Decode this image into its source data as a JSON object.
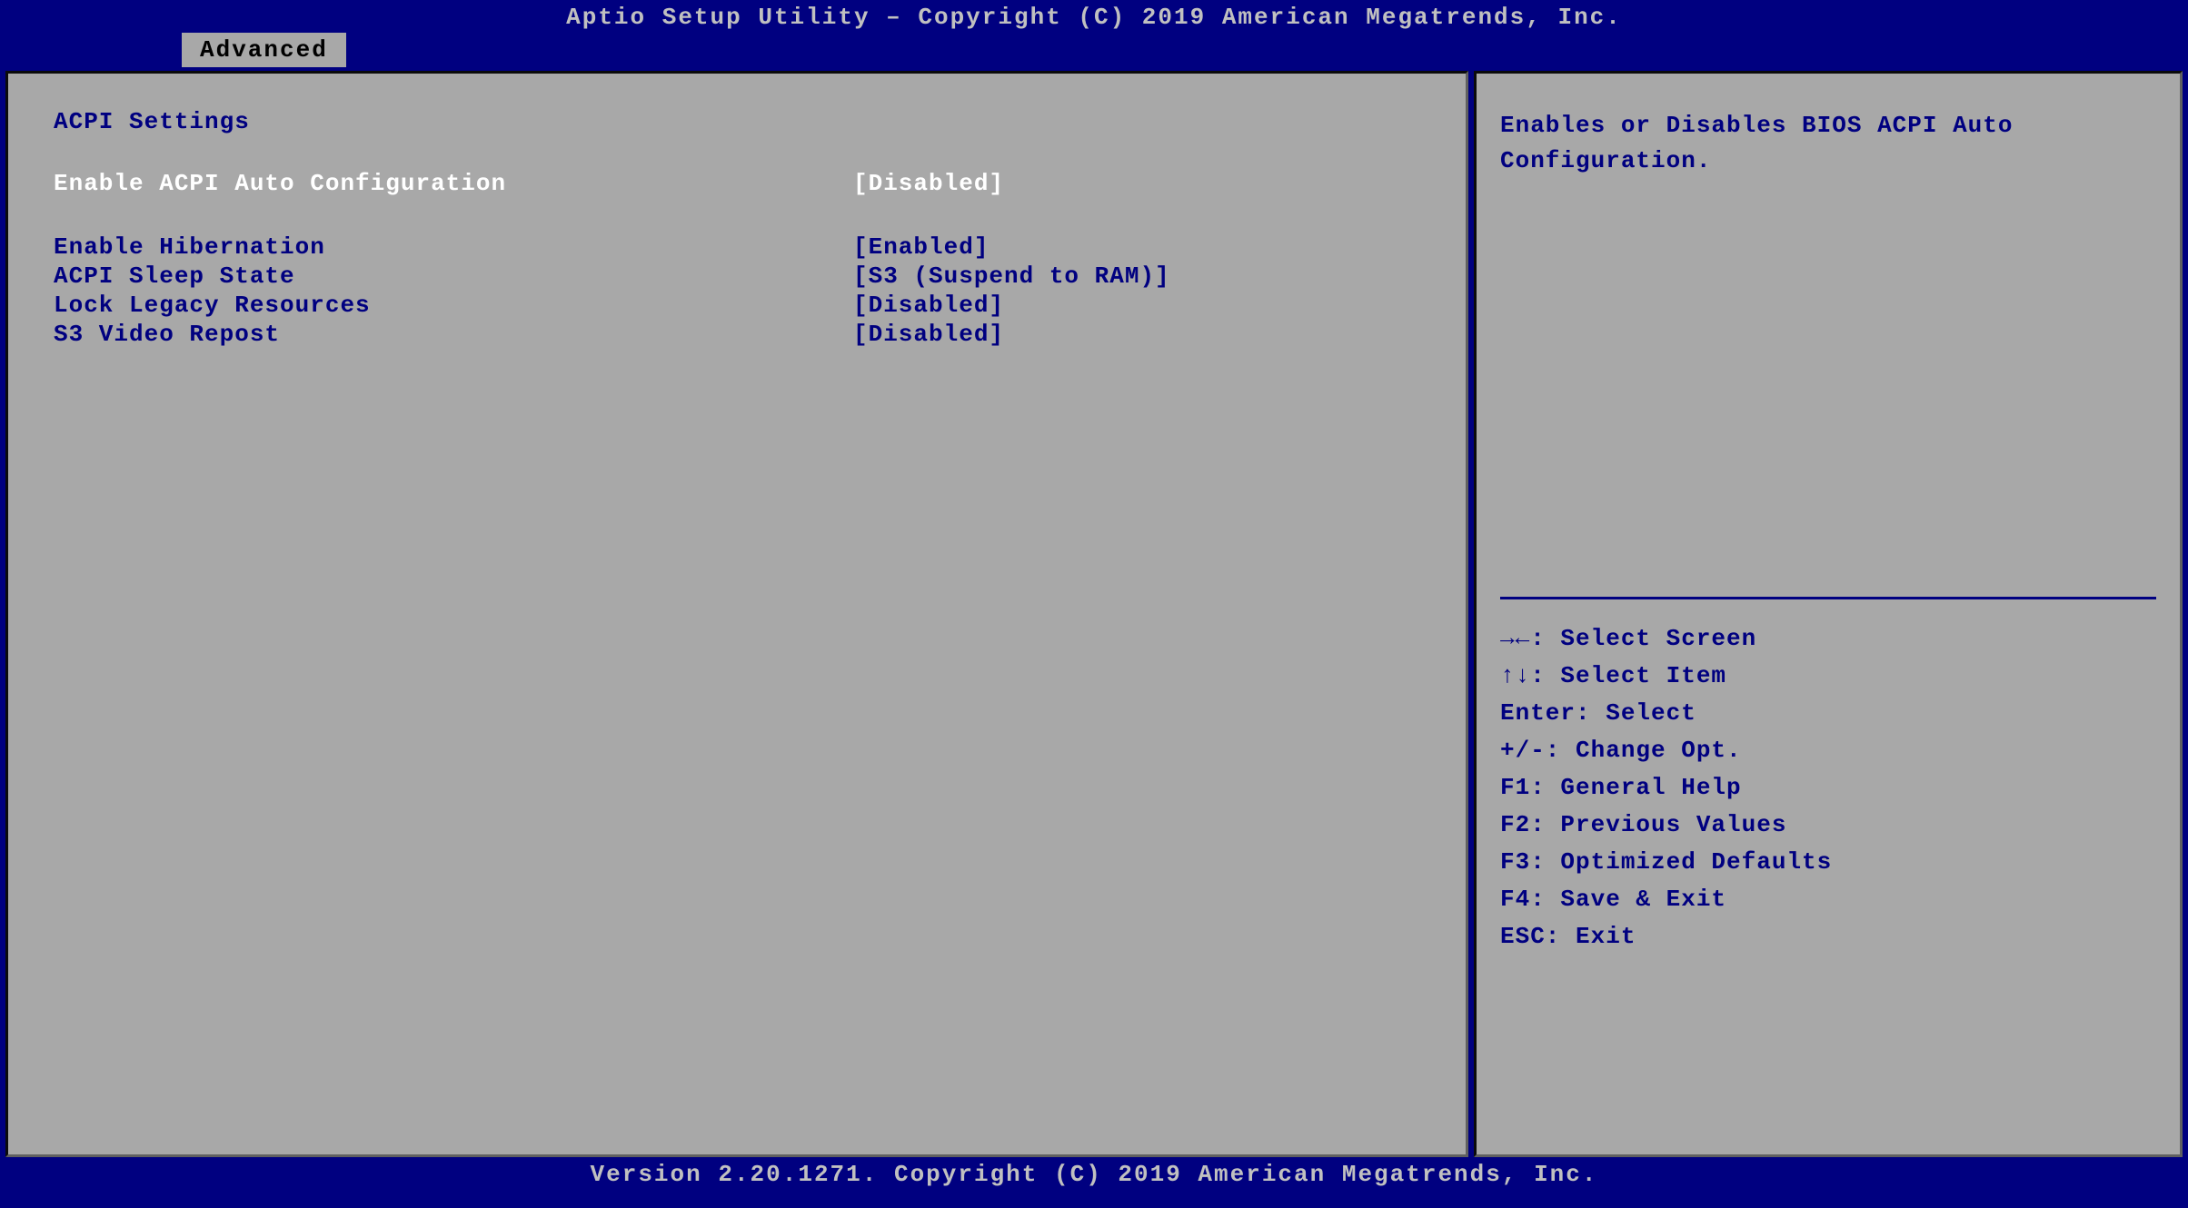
{
  "header": {
    "title": "Aptio Setup Utility – Copyright (C) 2019 American Megatrends, Inc."
  },
  "tab": {
    "label": "Advanced"
  },
  "panel_title": "ACPI Settings",
  "settings": [
    {
      "label": "Enable ACPI Auto Configuration",
      "value": "[Disabled]",
      "selected": true
    },
    {
      "label": "Enable Hibernation",
      "value": "[Enabled]",
      "selected": false
    },
    {
      "label": "ACPI Sleep State",
      "value": "[S3 (Suspend to RAM)]",
      "selected": false
    },
    {
      "label": "Lock Legacy Resources",
      "value": "[Disabled]",
      "selected": false
    },
    {
      "label": "S3 Video Repost",
      "value": "[Disabled]",
      "selected": false
    }
  ],
  "help_text": "Enables or Disables BIOS ACPI Auto Configuration.",
  "key_help": {
    "select_screen": "→←: Select Screen",
    "select_item": "↑↓: Select Item",
    "enter": "Enter: Select",
    "change_opt": "+/-: Change Opt.",
    "f1": "F1: General Help",
    "f2": "F2: Previous Values",
    "f3": "F3: Optimized Defaults",
    "f4": "F4: Save & Exit",
    "esc": "ESC: Exit"
  },
  "footer": {
    "text": "Version 2.20.1271. Copyright (C) 2019 American Megatrends, Inc."
  }
}
